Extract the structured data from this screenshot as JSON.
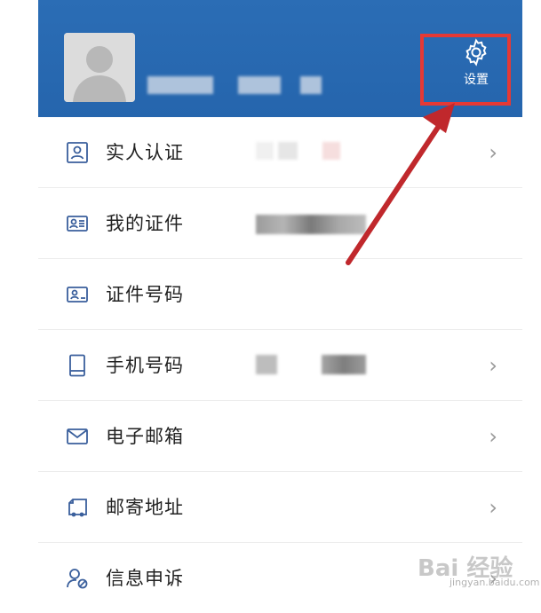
{
  "header": {
    "settings_label": "设置",
    "accent_color": "#2565ad",
    "highlight_color": "#e53935"
  },
  "menu": {
    "items": [
      {
        "label": "实人认证",
        "icon": "user-verify-icon"
      },
      {
        "label": "我的证件",
        "icon": "id-card-icon"
      },
      {
        "label": "证件号码",
        "icon": "id-number-icon"
      },
      {
        "label": "手机号码",
        "icon": "phone-icon"
      },
      {
        "label": "电子邮箱",
        "icon": "mail-icon"
      },
      {
        "label": "邮寄地址",
        "icon": "mailing-address-icon"
      },
      {
        "label": "信息申诉",
        "icon": "user-appeal-icon"
      }
    ]
  },
  "watermark": {
    "brand": "Bai 经验",
    "url": "jingyan.baidu.com"
  }
}
